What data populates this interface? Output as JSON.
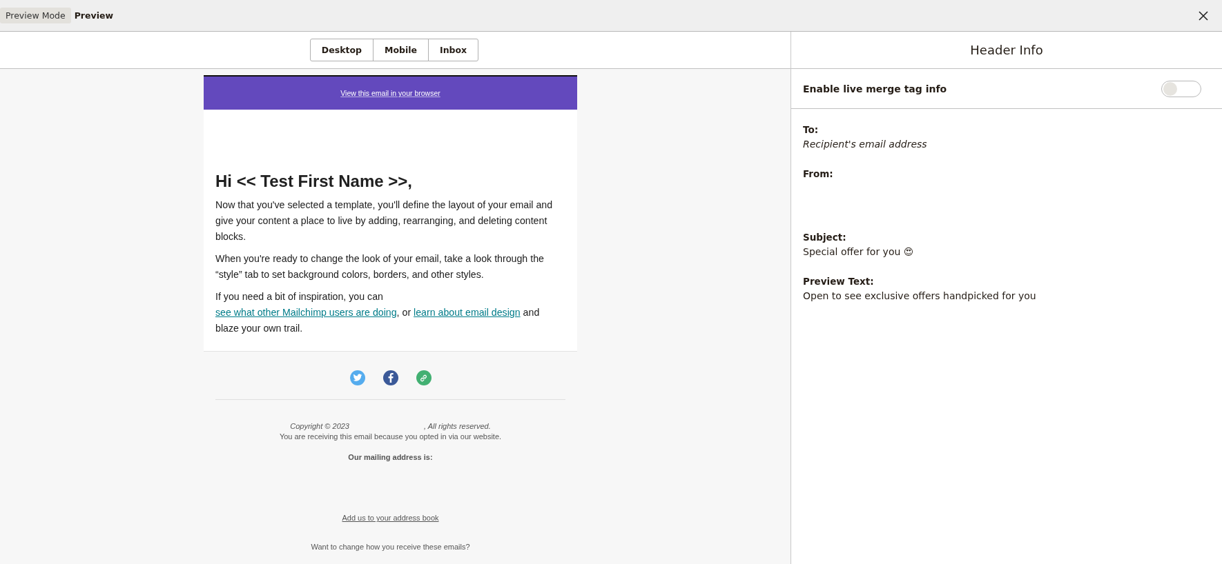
{
  "top_bar": {
    "mode_label": "Preview Mode",
    "title": "Preview"
  },
  "view_tabs": [
    {
      "label": "Desktop",
      "selected": false
    },
    {
      "label": "Mobile",
      "selected": false
    },
    {
      "label": "Inbox",
      "selected": false
    }
  ],
  "email": {
    "banner_link": "View this email in your browser",
    "heading": "Hi << Test First Name >>,",
    "paragraphs": [
      "Now that you've selected a template, you'll define the layout of your email and give your content a place to live by adding, rearranging, and deleting content blocks.",
      "When you're ready to change the look of your email, take a look through the “style” tab to set background colors, borders, and other styles."
    ],
    "inspiration": {
      "before": "If you need a bit of inspiration, you can ",
      "link_1": "see what other Mailchimp users are doing",
      "middle": ", or ",
      "link_2": "learn about email design",
      "after": " and blaze your own trail."
    },
    "social": [
      {
        "kind": "bird",
        "color": "#55acee"
      },
      {
        "kind": "f",
        "color": "#3b5998"
      },
      {
        "kind": "link",
        "color": "#42b072"
      }
    ],
    "footer": {
      "copyright": "Copyright © 2023",
      "rights": ", All rights reserved.",
      "reason": "You are receiving this email because you opted in via our website.",
      "address_label": "Our mailing address is:",
      "address_book_link": "Add us to your address book",
      "change_prompt": "Want to change how you receive these emails?"
    }
  },
  "header_info": {
    "title": "Header Info",
    "live_merge": {
      "label": "Enable live merge tag info",
      "on": false
    },
    "fields": [
      {
        "label": "To:",
        "value": "Recipient's email address",
        "kind": "placeholder"
      },
      {
        "label": "From:",
        "kind": "blank"
      },
      {
        "label": "Subject:",
        "value": "Special offer for you 😍",
        "kind": "text"
      },
      {
        "label": "Preview Text:",
        "value": "Open to see exclusive offers handpicked for you",
        "kind": "text"
      }
    ]
  }
}
